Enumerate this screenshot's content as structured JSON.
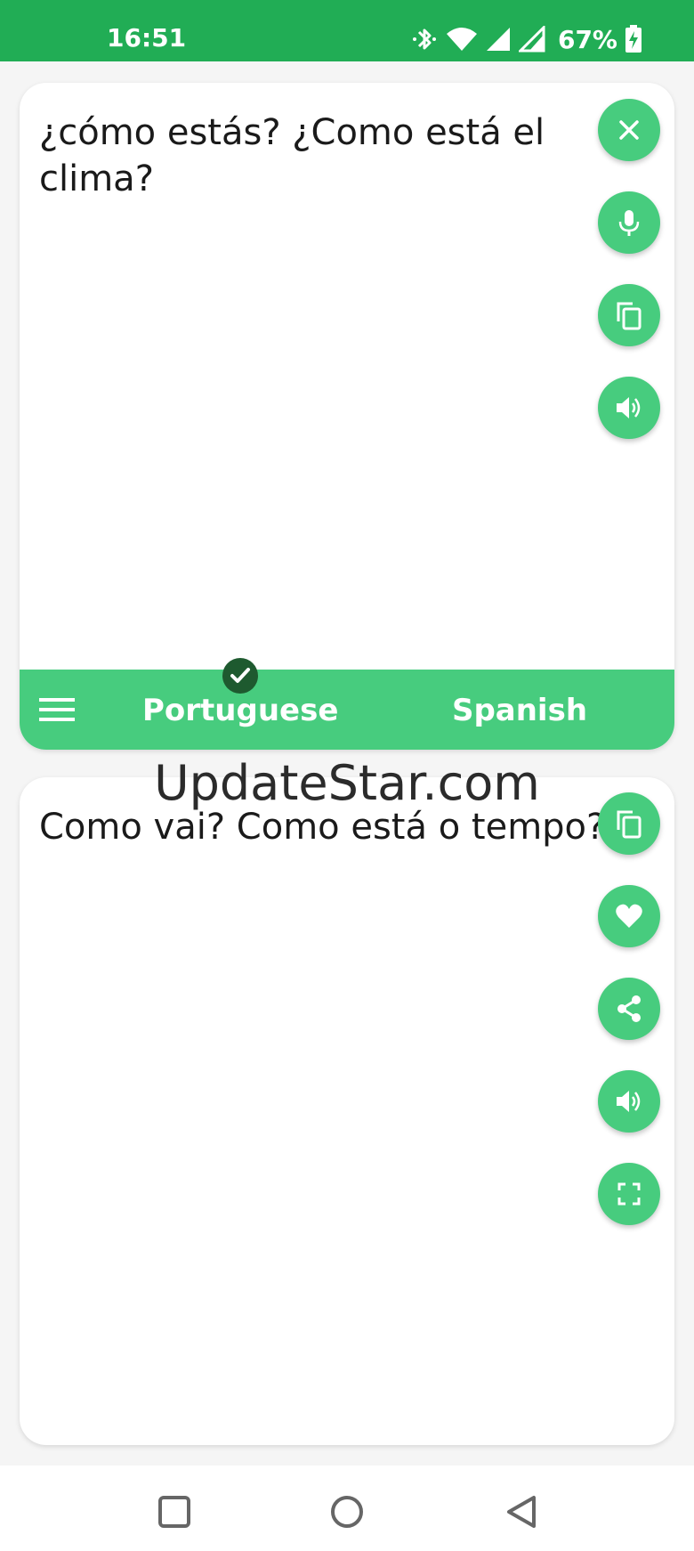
{
  "status_bar": {
    "time": "16:51",
    "battery": "67%",
    "icons": [
      "bluetooth-icon",
      "wifi-icon",
      "signal-icon",
      "signal-icon",
      "battery-charging-icon"
    ]
  },
  "source": {
    "text": "¿cómo estás? ¿Como está el clima?",
    "actions": [
      "clear-icon",
      "microphone-icon",
      "copy-icon",
      "speaker-icon"
    ]
  },
  "language_bar": {
    "source_language": "Portuguese",
    "target_language": "Spanish"
  },
  "watermark": "UpdateStar.com",
  "translation": {
    "text": "Como vai? Como está o tempo?",
    "actions": [
      "copy-icon",
      "heart-icon",
      "share-icon",
      "speaker-icon",
      "fullscreen-icon"
    ]
  },
  "colors": {
    "status_bar": "#21ad55",
    "accent": "#47cc7e",
    "check_badge": "#1e5a2f"
  }
}
